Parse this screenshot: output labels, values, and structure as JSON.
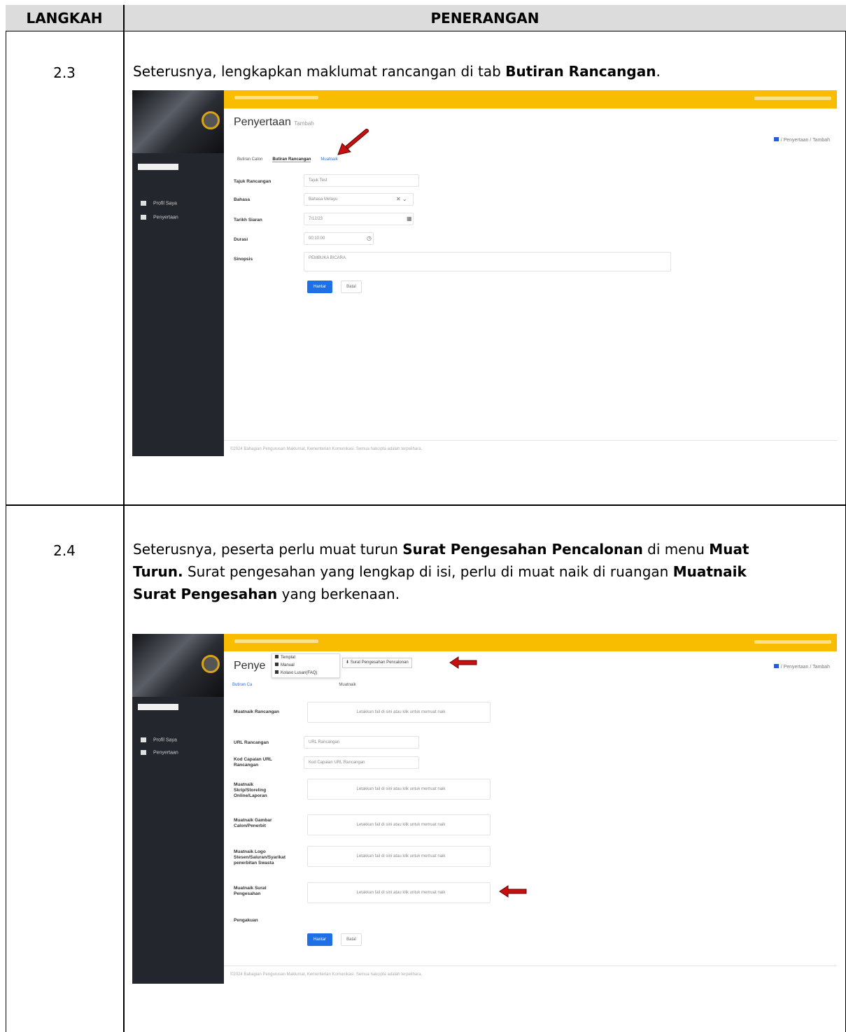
{
  "header": {
    "col1": "LANGKAH",
    "col2": "PENERANGAN"
  },
  "steps": [
    {
      "number": "2.3",
      "text_parts": [
        "Seterusnya, lengkapkan maklumat rancangan di tab ",
        "Butiran Rancangan",
        "."
      ],
      "screenshot": {
        "page_title": "Penyertaan",
        "page_subtitle": "Tambah",
        "breadcrumb": "/ Penyertaan / Tambah",
        "tabs": [
          "Butiran Calon",
          "Butiran Rancangan",
          "Muatnaik"
        ],
        "sidebar": [
          "Profil Saya",
          "Penyertaan"
        ],
        "fields": [
          {
            "label": "Tajuk Rancangan",
            "value": "Tajuk Test"
          },
          {
            "label": "Bahasa",
            "value": "Bahasa Melayu"
          },
          {
            "label": "Tarikh Siaran",
            "value": "7/12/23"
          },
          {
            "label": "Durasi",
            "value": "00:10:00"
          },
          {
            "label": "Sinopsis",
            "value": "PEMBUKA BICARA"
          }
        ],
        "buttons": {
          "submit": "Hantar",
          "cancel": "Batal"
        },
        "footer": "©2024 Bahagian Pengurusan Maklumat, Kementerian Komunikasi. Semua hakcipta adalah terpelihara."
      }
    },
    {
      "number": "2.4",
      "line1_parts": [
        "Seterusnya, peserta perlu muat turun ",
        "Surat Pengesahan Pencalonan",
        " di menu ",
        "Muat"
      ],
      "line2_parts": [
        "Turun.",
        "  Surat pengesahan yang lengkap di isi, perlu di muat naik di ruangan ",
        "Muatnaik"
      ],
      "line3_parts": [
        "Surat Pengesahan",
        " yang berkenaan."
      ],
      "screenshot": {
        "page_title": "Penye",
        "breadcrumb": "/ Penyertaan / Tambah",
        "tabs": [
          "Butiran Ca",
          "Muatnaik"
        ],
        "dropdown": [
          "Templat",
          "Manual",
          "Kolaso Lusan(FAQ)"
        ],
        "download_button": "Surat Pengesahan Pencalonan",
        "sidebar": [
          "Profil Saya",
          "Penyertaan"
        ],
        "upload_hint": "Letakkan fail di sini atau klik untuk memuat naik",
        "fields": [
          {
            "label": "Muatnaik Rancangan"
          },
          {
            "label": "URL Rancangan",
            "placeholder": "URL Rancangan"
          },
          {
            "label": "Kod Capaian URL Rancangan",
            "placeholder": "Kod Capaian URL Rancangan"
          },
          {
            "label": "Muatnaik Skrip/Storeling Online/Laporan"
          },
          {
            "label": "Muatnaik Gambar Calon/Penerbit"
          },
          {
            "label": "Muatnaik Logo Stesen/Saluran/Syarikat penerbitan Swasta"
          },
          {
            "label": "Muatnaik Surat Pengesahan"
          },
          {
            "label": "Pengakuan"
          }
        ],
        "buttons": {
          "submit": "Hantar",
          "cancel": "Batal"
        },
        "footer": "©2024 Bahagian Pengurusan Maklumat, Kementerian Komunikasi. Semua hakcipta adalah terpelihara."
      }
    }
  ],
  "colors": {
    "topbar": "#f8bd00",
    "sidebar": "#23262d",
    "primary": "#1f6fe5",
    "arrow": "#c81010"
  }
}
